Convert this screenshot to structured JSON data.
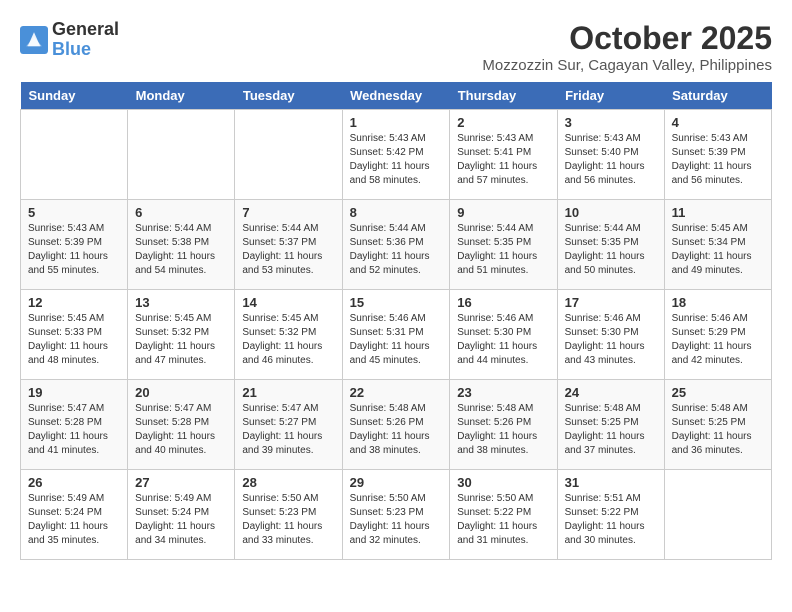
{
  "header": {
    "logo_line1": "General",
    "logo_line2": "Blue",
    "month": "October 2025",
    "location": "Mozzozzin Sur, Cagayan Valley, Philippines"
  },
  "weekdays": [
    "Sunday",
    "Monday",
    "Tuesday",
    "Wednesday",
    "Thursday",
    "Friday",
    "Saturday"
  ],
  "weeks": [
    [
      {
        "day": "",
        "detail": ""
      },
      {
        "day": "",
        "detail": ""
      },
      {
        "day": "",
        "detail": ""
      },
      {
        "day": "1",
        "detail": "Sunrise: 5:43 AM\nSunset: 5:42 PM\nDaylight: 11 hours\nand 58 minutes."
      },
      {
        "day": "2",
        "detail": "Sunrise: 5:43 AM\nSunset: 5:41 PM\nDaylight: 11 hours\nand 57 minutes."
      },
      {
        "day": "3",
        "detail": "Sunrise: 5:43 AM\nSunset: 5:40 PM\nDaylight: 11 hours\nand 56 minutes."
      },
      {
        "day": "4",
        "detail": "Sunrise: 5:43 AM\nSunset: 5:39 PM\nDaylight: 11 hours\nand 56 minutes."
      }
    ],
    [
      {
        "day": "5",
        "detail": "Sunrise: 5:43 AM\nSunset: 5:39 PM\nDaylight: 11 hours\nand 55 minutes."
      },
      {
        "day": "6",
        "detail": "Sunrise: 5:44 AM\nSunset: 5:38 PM\nDaylight: 11 hours\nand 54 minutes."
      },
      {
        "day": "7",
        "detail": "Sunrise: 5:44 AM\nSunset: 5:37 PM\nDaylight: 11 hours\nand 53 minutes."
      },
      {
        "day": "8",
        "detail": "Sunrise: 5:44 AM\nSunset: 5:36 PM\nDaylight: 11 hours\nand 52 minutes."
      },
      {
        "day": "9",
        "detail": "Sunrise: 5:44 AM\nSunset: 5:35 PM\nDaylight: 11 hours\nand 51 minutes."
      },
      {
        "day": "10",
        "detail": "Sunrise: 5:44 AM\nSunset: 5:35 PM\nDaylight: 11 hours\nand 50 minutes."
      },
      {
        "day": "11",
        "detail": "Sunrise: 5:45 AM\nSunset: 5:34 PM\nDaylight: 11 hours\nand 49 minutes."
      }
    ],
    [
      {
        "day": "12",
        "detail": "Sunrise: 5:45 AM\nSunset: 5:33 PM\nDaylight: 11 hours\nand 48 minutes."
      },
      {
        "day": "13",
        "detail": "Sunrise: 5:45 AM\nSunset: 5:32 PM\nDaylight: 11 hours\nand 47 minutes."
      },
      {
        "day": "14",
        "detail": "Sunrise: 5:45 AM\nSunset: 5:32 PM\nDaylight: 11 hours\nand 46 minutes."
      },
      {
        "day": "15",
        "detail": "Sunrise: 5:46 AM\nSunset: 5:31 PM\nDaylight: 11 hours\nand 45 minutes."
      },
      {
        "day": "16",
        "detail": "Sunrise: 5:46 AM\nSunset: 5:30 PM\nDaylight: 11 hours\nand 44 minutes."
      },
      {
        "day": "17",
        "detail": "Sunrise: 5:46 AM\nSunset: 5:30 PM\nDaylight: 11 hours\nand 43 minutes."
      },
      {
        "day": "18",
        "detail": "Sunrise: 5:46 AM\nSunset: 5:29 PM\nDaylight: 11 hours\nand 42 minutes."
      }
    ],
    [
      {
        "day": "19",
        "detail": "Sunrise: 5:47 AM\nSunset: 5:28 PM\nDaylight: 11 hours\nand 41 minutes."
      },
      {
        "day": "20",
        "detail": "Sunrise: 5:47 AM\nSunset: 5:28 PM\nDaylight: 11 hours\nand 40 minutes."
      },
      {
        "day": "21",
        "detail": "Sunrise: 5:47 AM\nSunset: 5:27 PM\nDaylight: 11 hours\nand 39 minutes."
      },
      {
        "day": "22",
        "detail": "Sunrise: 5:48 AM\nSunset: 5:26 PM\nDaylight: 11 hours\nand 38 minutes."
      },
      {
        "day": "23",
        "detail": "Sunrise: 5:48 AM\nSunset: 5:26 PM\nDaylight: 11 hours\nand 38 minutes."
      },
      {
        "day": "24",
        "detail": "Sunrise: 5:48 AM\nSunset: 5:25 PM\nDaylight: 11 hours\nand 37 minutes."
      },
      {
        "day": "25",
        "detail": "Sunrise: 5:48 AM\nSunset: 5:25 PM\nDaylight: 11 hours\nand 36 minutes."
      }
    ],
    [
      {
        "day": "26",
        "detail": "Sunrise: 5:49 AM\nSunset: 5:24 PM\nDaylight: 11 hours\nand 35 minutes."
      },
      {
        "day": "27",
        "detail": "Sunrise: 5:49 AM\nSunset: 5:24 PM\nDaylight: 11 hours\nand 34 minutes."
      },
      {
        "day": "28",
        "detail": "Sunrise: 5:50 AM\nSunset: 5:23 PM\nDaylight: 11 hours\nand 33 minutes."
      },
      {
        "day": "29",
        "detail": "Sunrise: 5:50 AM\nSunset: 5:23 PM\nDaylight: 11 hours\nand 32 minutes."
      },
      {
        "day": "30",
        "detail": "Sunrise: 5:50 AM\nSunset: 5:22 PM\nDaylight: 11 hours\nand 31 minutes."
      },
      {
        "day": "31",
        "detail": "Sunrise: 5:51 AM\nSunset: 5:22 PM\nDaylight: 11 hours\nand 30 minutes."
      },
      {
        "day": "",
        "detail": ""
      }
    ]
  ]
}
